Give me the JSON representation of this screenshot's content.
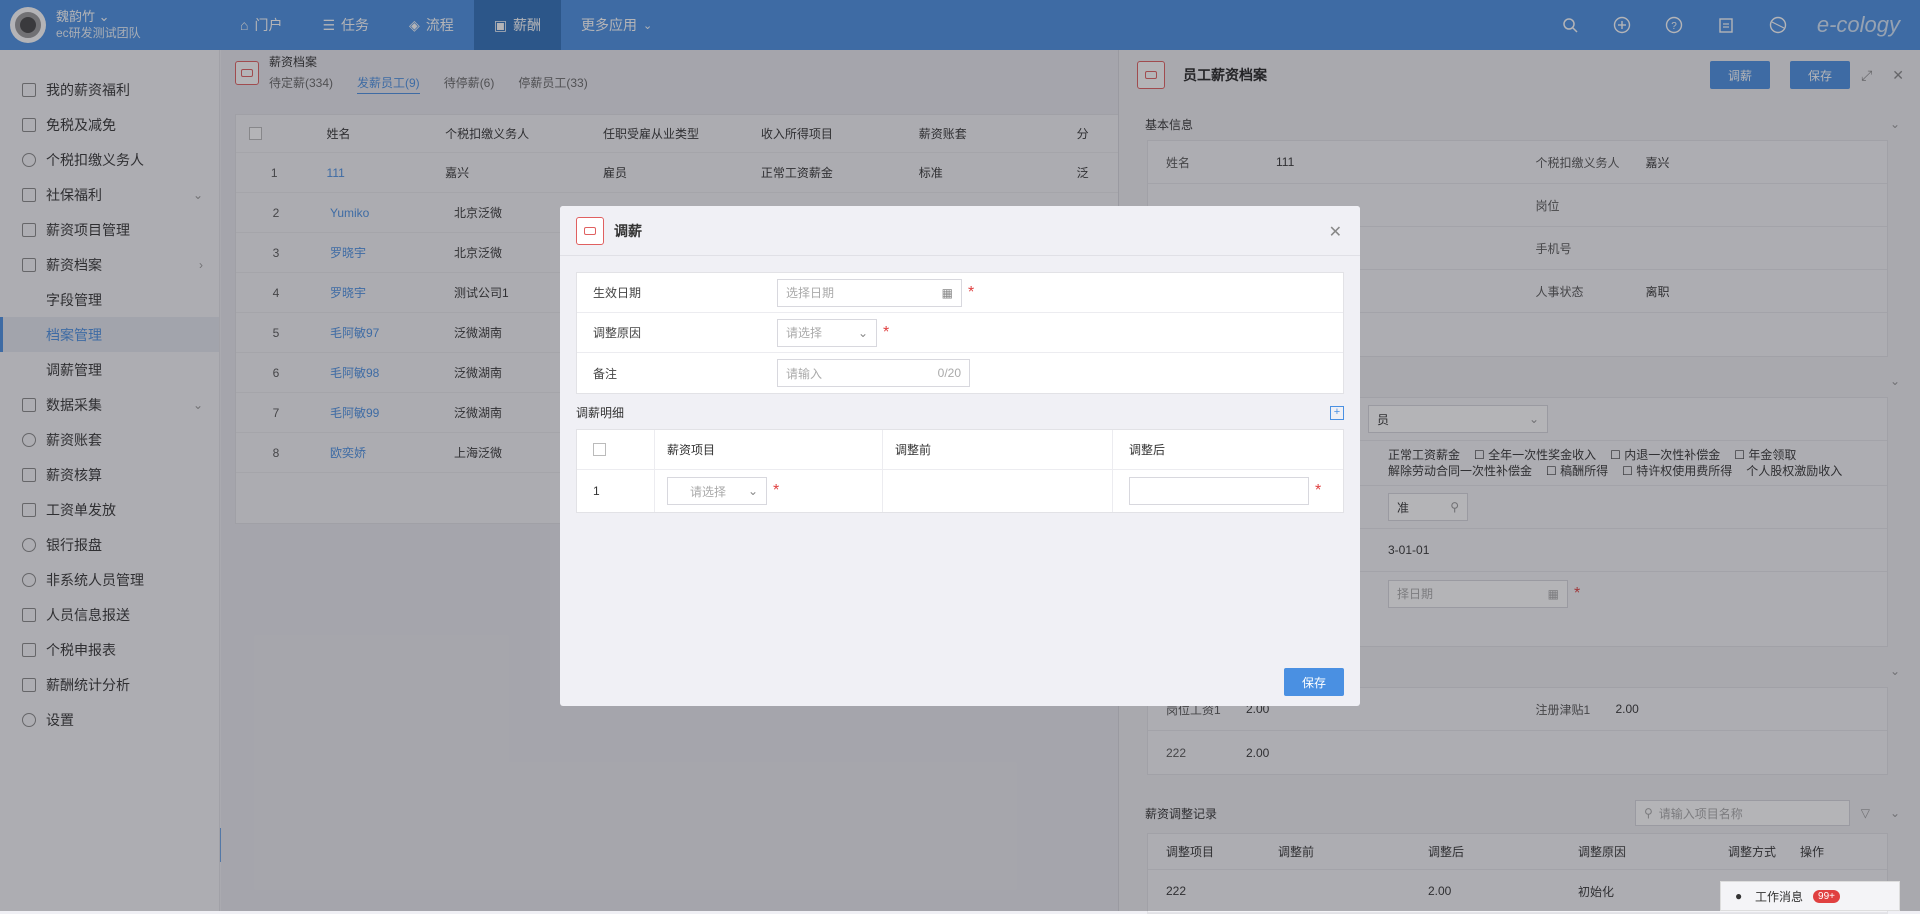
{
  "topbar": {
    "user_name": "魏韵竹",
    "team": "ec研发测试团队",
    "nav": [
      "门户",
      "任务",
      "流程",
      "薪酬",
      "更多应用"
    ],
    "nav_icons": [
      "home-icon",
      "list-icon",
      "layers-icon",
      "money-icon",
      ""
    ],
    "brand": "e-cology",
    "accent": "#4a90e2"
  },
  "sidebar": {
    "items": [
      {
        "label": "我的薪资福利",
        "icon": "doc-icon"
      },
      {
        "label": "免税及减免",
        "icon": "doc-icon"
      },
      {
        "label": "个税扣缴义务人",
        "icon": "user-icon"
      },
      {
        "label": "社保福利",
        "icon": "shield-icon"
      },
      {
        "label": "薪资项目管理",
        "icon": "grid-icon"
      },
      {
        "label": "薪资档案",
        "icon": "folder-icon"
      },
      {
        "label": "字段管理",
        "icon": ""
      },
      {
        "label": "档案管理",
        "icon": ""
      },
      {
        "label": "调薪管理",
        "icon": ""
      },
      {
        "label": "数据采集",
        "icon": "data-icon"
      },
      {
        "label": "薪资账套",
        "icon": "set-icon"
      },
      {
        "label": "薪资核算",
        "icon": "calc-icon"
      },
      {
        "label": "工资单发放",
        "icon": "send-icon"
      },
      {
        "label": "银行报盘",
        "icon": "bank-icon"
      },
      {
        "label": "非系统人员管理",
        "icon": "user-icon"
      },
      {
        "label": "人员信息报送",
        "icon": "report-icon"
      },
      {
        "label": "个税申报表",
        "icon": "tax-icon"
      },
      {
        "label": "薪酬统计分析",
        "icon": "chart-icon"
      },
      {
        "label": "设置",
        "icon": "gear-icon"
      }
    ]
  },
  "archive": {
    "title": "薪资档案",
    "tabs": [
      "待定薪(334)",
      "发薪员工(9)",
      "待停薪(6)",
      "停薪员工(33)"
    ],
    "columns": [
      "姓名",
      "个税扣缴义务人",
      "任职受雇从业类型",
      "收入所得项目",
      "薪资账套",
      "分"
    ],
    "rows": [
      {
        "no": "1",
        "name": "111",
        "tax": "嘉兴",
        "type": "雇员",
        "income": "正常工资薪金",
        "set": "标准",
        "more": "泛"
      },
      {
        "no": "2",
        "name": "Yumiko",
        "tax": "北京泛微",
        "type": "",
        "income": "",
        "set": "",
        "more": ""
      },
      {
        "no": "3",
        "name": "罗晓宇",
        "tax": "北京泛微",
        "type": "",
        "income": "",
        "set": "",
        "more": ""
      },
      {
        "no": "4",
        "name": "罗晓宇",
        "tax": "测试公司1",
        "type": "",
        "income": "",
        "set": "",
        "more": ""
      },
      {
        "no": "5",
        "name": "毛阿敏97",
        "tax": "泛微湖南",
        "type": "",
        "income": "",
        "set": "",
        "more": ""
      },
      {
        "no": "6",
        "name": "毛阿敏98",
        "tax": "泛微湖南",
        "type": "",
        "income": "",
        "set": "",
        "more": ""
      },
      {
        "no": "7",
        "name": "毛阿敏99",
        "tax": "泛微湖南",
        "type": "",
        "income": "",
        "set": "",
        "more": ""
      },
      {
        "no": "8",
        "name": "欧奕娇",
        "tax": "上海泛微",
        "type": "",
        "income": "",
        "set": "",
        "more": ""
      }
    ]
  },
  "panel": {
    "title": "员工薪资档案",
    "adjust_btn": "调薪",
    "save_btn": "保存",
    "basic_title": "基本信息",
    "basic": {
      "name_label": "姓名",
      "name": "111",
      "tax_label": "个税扣缴义务人",
      "tax": "嘉兴",
      "post_label": "岗位",
      "phone_label": "手机号",
      "status_label": "人事状态",
      "status": "离职"
    },
    "type_partial": "员",
    "income_options": [
      "正常工资薪金",
      "全年一次性奖金收入",
      "内退一次性补偿金",
      "年金领取",
      "解除劳动合同一次性补偿金",
      "稿酬所得",
      "特许权使用费所得",
      "个人股权激励收入"
    ],
    "set_partial": "准",
    "date_partial": "3-01-01",
    "date_placeholder_partial": "择日期",
    "salary_rows": [
      {
        "l1": "岗位工资1",
        "v1": "2.00",
        "l2": "注册津贴1",
        "v2": "2.00"
      },
      {
        "l1": "222",
        "v1": "2.00",
        "l2": "",
        "v2": ""
      }
    ],
    "records_title": "薪资调整记录",
    "records_search_placeholder": "请输入项目名称",
    "records_columns": [
      "调整项目",
      "调整前",
      "调整后",
      "调整原因",
      "调整方式",
      "操作"
    ],
    "records_rows": [
      {
        "item": "222",
        "before": "",
        "after": "2.00",
        "reason": "初始化"
      }
    ]
  },
  "modal": {
    "title": "调薪",
    "effective_label": "生效日期",
    "effective_placeholder": "选择日期",
    "reason_label": "调整原因",
    "reason_placeholder": "请选择",
    "note_label": "备注",
    "note_placeholder": "请输入",
    "note_count": "0/20",
    "detail_title": "调薪明细",
    "detail_columns": [
      "薪资项目",
      "调整前",
      "调整后"
    ],
    "detail_row_no": "1",
    "detail_item_placeholder": "请选择",
    "save_btn": "保存"
  },
  "messages": {
    "label": "工作消息",
    "count": "99+"
  }
}
